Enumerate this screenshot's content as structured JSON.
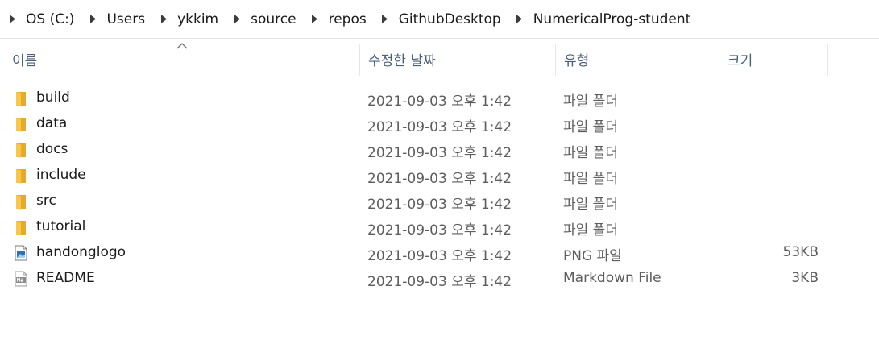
{
  "breadcrumb": [
    "OS (C:)",
    "Users",
    "ykkim",
    "source",
    "repos",
    "GithubDesktop",
    "NumericalProg-student"
  ],
  "columns": {
    "name": "이름",
    "date": "수정한 날짜",
    "type": "유형",
    "size": "크기"
  },
  "files": [
    {
      "icon": "folder-icon",
      "name": "build",
      "date": "2021-09-03 오후 1:42",
      "type": "파일 폴더",
      "size": ""
    },
    {
      "icon": "folder-icon",
      "name": "data",
      "date": "2021-09-03 오후 1:42",
      "type": "파일 폴더",
      "size": ""
    },
    {
      "icon": "folder-icon",
      "name": "docs",
      "date": "2021-09-03 오후 1:42",
      "type": "파일 폴더",
      "size": ""
    },
    {
      "icon": "folder-icon",
      "name": "include",
      "date": "2021-09-03 오후 1:42",
      "type": "파일 폴더",
      "size": ""
    },
    {
      "icon": "folder-icon",
      "name": "src",
      "date": "2021-09-03 오후 1:42",
      "type": "파일 폴더",
      "size": ""
    },
    {
      "icon": "folder-icon",
      "name": "tutorial",
      "date": "2021-09-03 오후 1:42",
      "type": "파일 폴더",
      "size": ""
    },
    {
      "icon": "png-file-icon",
      "name": "handonglogo",
      "date": "2021-09-03 오후 1:42",
      "type": "PNG 파일",
      "size": "53KB"
    },
    {
      "icon": "markdown-file-icon",
      "name": "README",
      "date": "2021-09-03 오후 1:42",
      "type": "Markdown File",
      "size": "3KB"
    }
  ],
  "colors": {
    "header_text": "#4c607a",
    "folder_yellow": "#f8c74a",
    "secondary_text": "#5d5d5d"
  }
}
